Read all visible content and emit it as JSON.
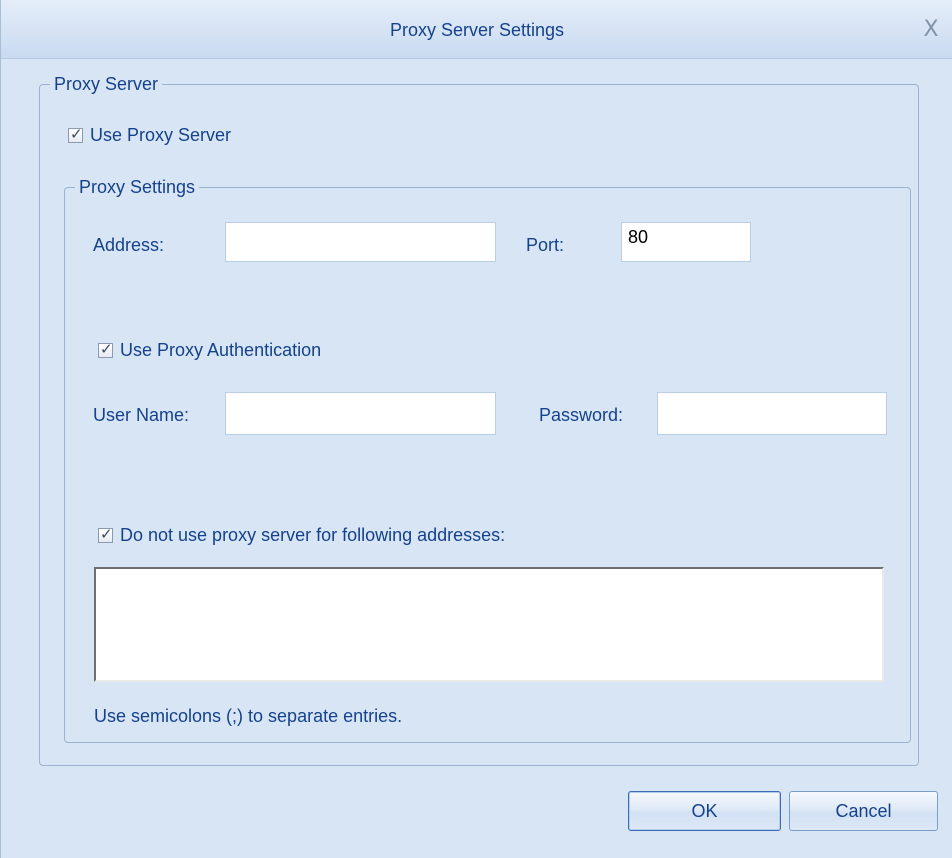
{
  "window": {
    "title": "Proxy Server Settings",
    "close_glyph": "X"
  },
  "proxy_server_group": {
    "legend": "Proxy Server",
    "use_proxy": {
      "label": "Use Proxy Server",
      "checked": true
    }
  },
  "proxy_settings_group": {
    "legend": "Proxy Settings",
    "address": {
      "label": "Address:",
      "value": ""
    },
    "port": {
      "label": "Port:",
      "value": "80"
    },
    "use_auth": {
      "label": "Use Proxy Authentication",
      "checked": true
    },
    "username": {
      "label": "User Name:",
      "value": ""
    },
    "password": {
      "label": "Password:",
      "value": ""
    },
    "bypass": {
      "label": "Do not use proxy server for following addresses:",
      "checked": true,
      "value": ""
    },
    "hint": "Use semicolons (;) to separate entries."
  },
  "buttons": {
    "ok": "OK",
    "cancel": "Cancel"
  },
  "colors": {
    "accent_text": "#15428b",
    "background": "#d8e5f5"
  },
  "check_glyph": "✓"
}
